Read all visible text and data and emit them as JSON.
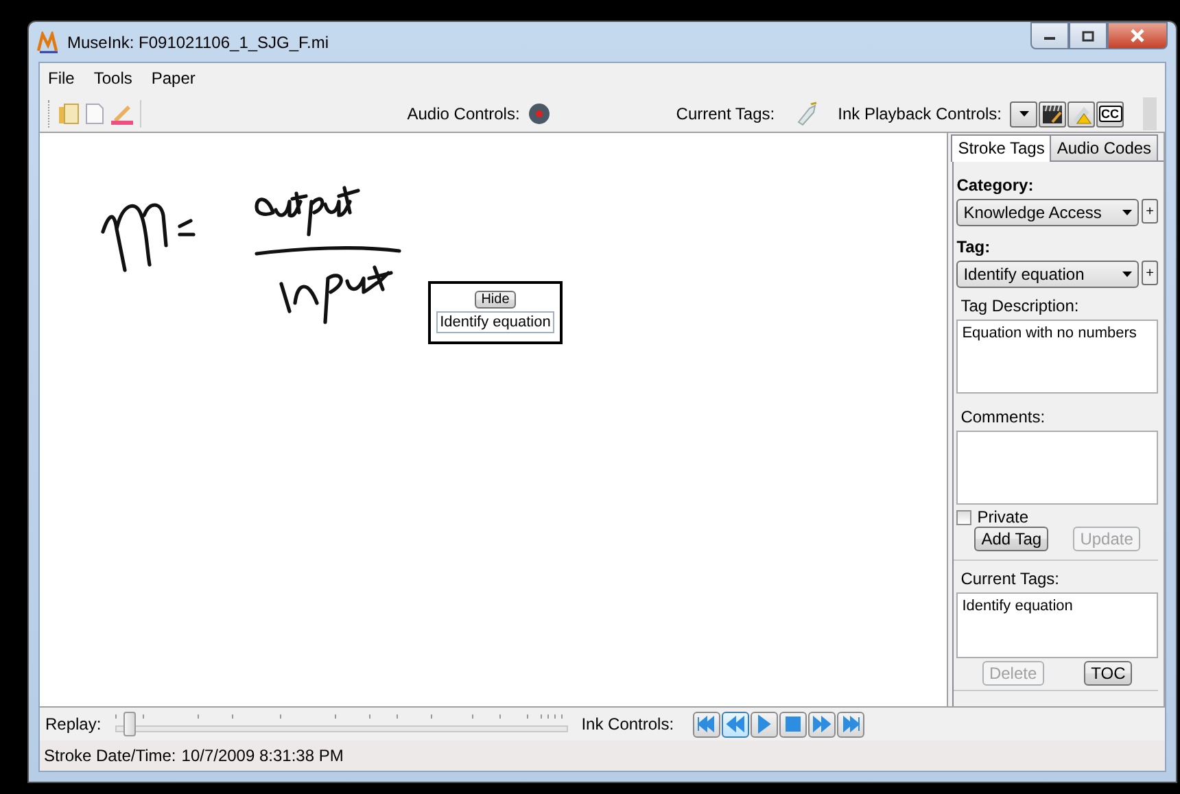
{
  "window": {
    "title": "MuseInk: F091021106_1_SJG_F.mi"
  },
  "menu": [
    "File",
    "Tools",
    "Paper"
  ],
  "toolbar": {
    "audio_label": "Audio Controls:",
    "tags_label": "Current Tags:",
    "playback_label": "Ink Playback Controls:",
    "playback_buttons": [
      {
        "kind": "dropdown"
      },
      {
        "kind": "clapper"
      },
      {
        "kind": "warning"
      },
      {
        "kind": "captions",
        "label": "CC"
      }
    ]
  },
  "canvas": {
    "popup": {
      "button": "Hide",
      "tag": "Identify equation"
    }
  },
  "panel": {
    "tabs": [
      {
        "label": "Stroke Tags",
        "selected": true
      },
      {
        "label": "Audio Codes",
        "selected": false
      }
    ],
    "category_label": "Category:",
    "category": "Knowledge Access",
    "category_add": "+",
    "tag_label": "Tag:",
    "tag": "Identify equation",
    "tag_add": "+",
    "description_label": "Tag Description:",
    "description": "Equation with no numbers",
    "comments_label": "Comments:",
    "private": {
      "label": "Private",
      "checked": false
    },
    "buttons": [
      {
        "label": "Add Tag",
        "disabled": false
      },
      {
        "label": "Update",
        "disabled": true
      }
    ],
    "current_tags_label": "Current Tags:",
    "current_tags": [
      "Identify equation"
    ],
    "list_buttons": [
      {
        "label": "Delete",
        "disabled": true
      },
      {
        "label": "TOC",
        "disabled": false
      }
    ]
  },
  "replay": {
    "label": "Replay:",
    "level": 0.03,
    "controls_label": "Ink Controls:",
    "controls": [
      {
        "kind": "first",
        "selected": false
      },
      {
        "kind": "rewind",
        "selected": true
      },
      {
        "kind": "play",
        "selected": false
      },
      {
        "kind": "stop",
        "selected": false
      },
      {
        "kind": "forward",
        "selected": false
      },
      {
        "kind": "last",
        "selected": false
      }
    ]
  },
  "status": {
    "label": "Stroke Date/Time:",
    "value": "10/7/2009 8:31:38 PM"
  }
}
